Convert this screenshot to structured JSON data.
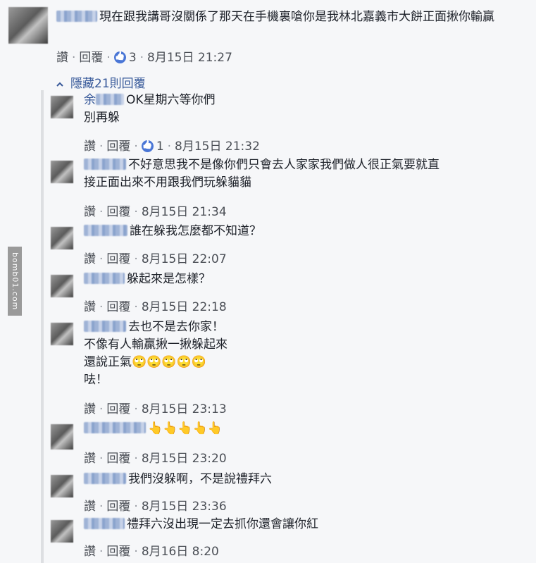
{
  "root": {
    "text": "現在跟我講哥沒關係了那天在手機裏嗆你是我林北嘉義市大餅正面揪你輸贏",
    "like_label": "讚",
    "reply_label": "回覆",
    "reactions": "3",
    "time": "8月15日 21:27"
  },
  "hide_replies_label": "隱藏21則回覆",
  "side_badge": "bomb01.com",
  "replies": [
    {
      "prefix": "余",
      "lines": [
        "OK星期六等你們",
        "別再躲"
      ],
      "reactions": "1",
      "time": "8月15日 21:32"
    },
    {
      "prefix": "",
      "lines": [
        "不好意思我不是像你們只會去人家家我們做人很正氣要就直",
        "接正面出來不用跟我們玩躲貓貓"
      ],
      "reactions": "",
      "time": "8月15日 21:34"
    },
    {
      "prefix": "",
      "lines": [
        "誰在躲我怎麼都不知道？"
      ],
      "reactions": "",
      "time": "8月15日 22:07"
    },
    {
      "prefix": "",
      "lines": [
        "躲起來是怎樣？"
      ],
      "reactions": "",
      "time": "8月15日 22:18"
    },
    {
      "prefix": "",
      "lines": [
        "去也不是去你家！",
        "不像有人輸贏揪一揪躲起來",
        "還說正氣🙄🙄🙄🙄🙄",
        "呿！"
      ],
      "reactions": "",
      "time": "8月15日 23:13"
    },
    {
      "prefix": "",
      "lines": [
        "👆👆👆👆👆"
      ],
      "reactions": "",
      "time": "8月15日 23:20"
    },
    {
      "prefix": "",
      "lines": [
        "我們沒躲啊，不是說禮拜六"
      ],
      "reactions": "",
      "time": "8月15日 23:36"
    },
    {
      "prefix": "",
      "lines": [
        "禮拜六沒出現一定去抓你還會讓你紅"
      ],
      "reactions": "",
      "time": "8月16日 8:20"
    }
  ],
  "action_labels": {
    "like": "讚",
    "reply": "回覆"
  }
}
